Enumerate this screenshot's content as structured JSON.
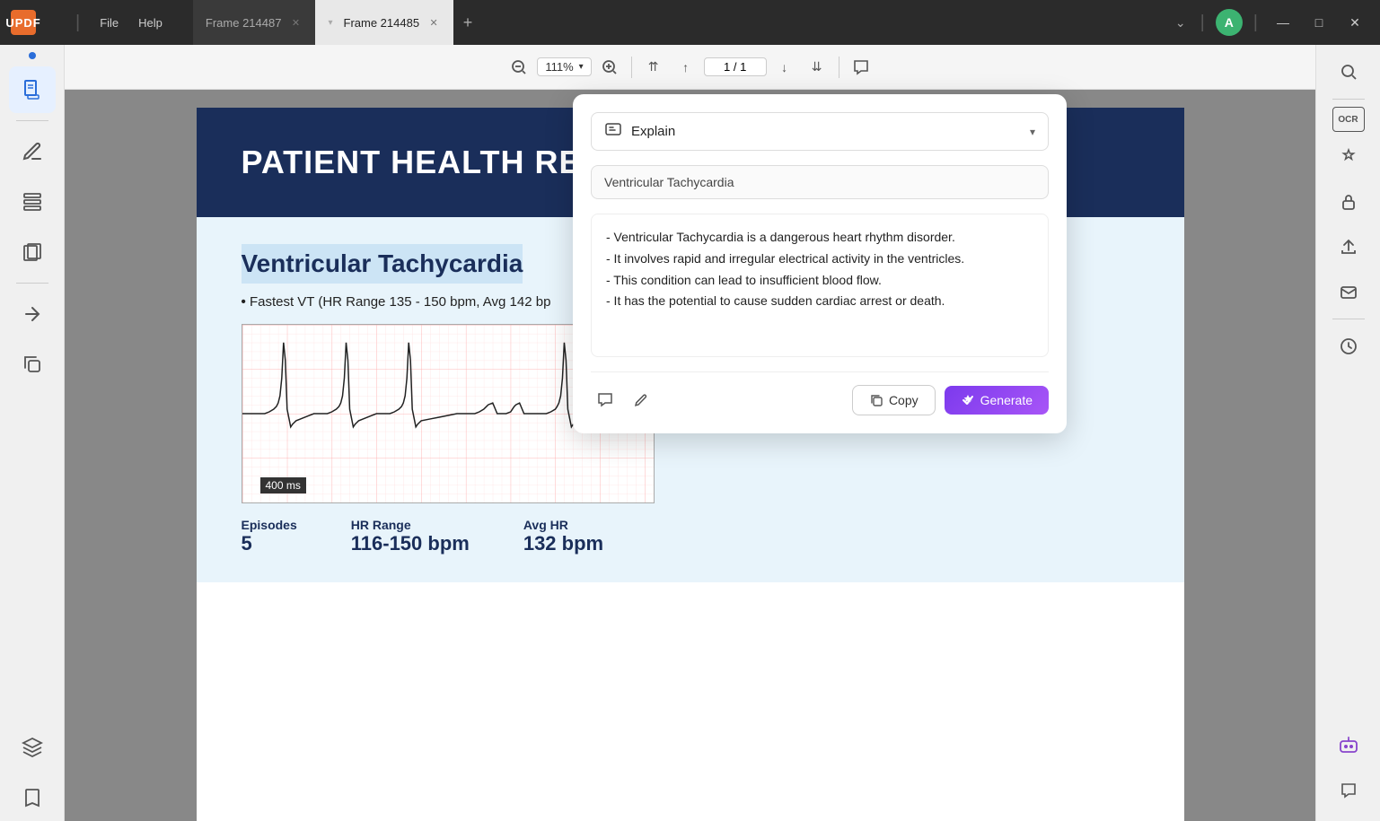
{
  "app": {
    "logo": "UPDF",
    "logo_letter": "U"
  },
  "titlebar": {
    "menu": [
      "File",
      "Help"
    ],
    "divider": "|",
    "tabs": [
      {
        "id": "tab1",
        "label": "Frame 214487",
        "active": false
      },
      {
        "id": "tab2",
        "label": "Frame 214485",
        "active": true
      }
    ],
    "add_tab": "+",
    "tabs_more": "⌄",
    "avatar_letter": "A",
    "win_minimize": "—",
    "win_maximize": "□",
    "win_close": "✕"
  },
  "toolbar": {
    "zoom_out": "−",
    "zoom_level": "111%",
    "zoom_dropdown": "▾",
    "zoom_in": "+",
    "page_first": "⇈",
    "page_prev": "↑",
    "page_current": "1",
    "page_sep": "/",
    "page_total": "1",
    "page_next": "↓",
    "page_last": "⇊",
    "comment": "💬"
  },
  "sidebar": {
    "items": [
      {
        "id": "read",
        "icon": "📄",
        "active": true
      },
      {
        "id": "edit",
        "icon": "✏️"
      },
      {
        "id": "organize",
        "icon": "📋"
      },
      {
        "id": "convert",
        "icon": "🔄"
      },
      {
        "id": "stamp",
        "icon": "🔖"
      },
      {
        "id": "layers",
        "icon": "⧉"
      },
      {
        "id": "bookmark",
        "icon": "🔖"
      }
    ]
  },
  "right_sidebar": {
    "items": [
      {
        "id": "search",
        "icon": "🔍"
      },
      {
        "id": "ocr",
        "icon": "OCR"
      },
      {
        "id": "ai",
        "icon": "✨"
      },
      {
        "id": "lock",
        "icon": "🔒"
      },
      {
        "id": "share",
        "icon": "↑"
      },
      {
        "id": "mail",
        "icon": "✉"
      },
      {
        "id": "history",
        "icon": "🕐"
      },
      {
        "id": "aibot",
        "icon": "🤖"
      },
      {
        "id": "chat",
        "icon": "💬"
      }
    ]
  },
  "document": {
    "header_title": "PATIENT HEALTH RECORD",
    "section_title": "Ventricular Tachycardia",
    "bullet": "Fastest VT (HR Range 135 - 150 bpm, Avg 142 bp",
    "ecg_label": "400 ms",
    "stats": [
      {
        "label": "Episodes",
        "value": "5"
      },
      {
        "label": "HR Range",
        "value": "116-150 bpm"
      },
      {
        "label": "Avg HR",
        "value": "132 bpm"
      }
    ]
  },
  "ai_panel": {
    "mode_label": "Explain",
    "input_value": "Ventricular Tachycardia",
    "result_text": "- Ventricular Tachycardia is a dangerous heart rhythm disorder.\n- It involves rapid and irregular electrical activity in the ventricles.\n- This condition can lead to insufficient blood flow.\n- It has the potential to cause sudden cardiac arrest or death.",
    "copy_label": "Copy",
    "generate_label": "Generate"
  },
  "colors": {
    "doc_header_bg": "#1a2e5a",
    "doc_body_bg": "#e8f4fb",
    "section_highlight": "#cce4f5",
    "generate_btn": "#7c3aed",
    "sidebar_active": "#2a6dd9"
  }
}
